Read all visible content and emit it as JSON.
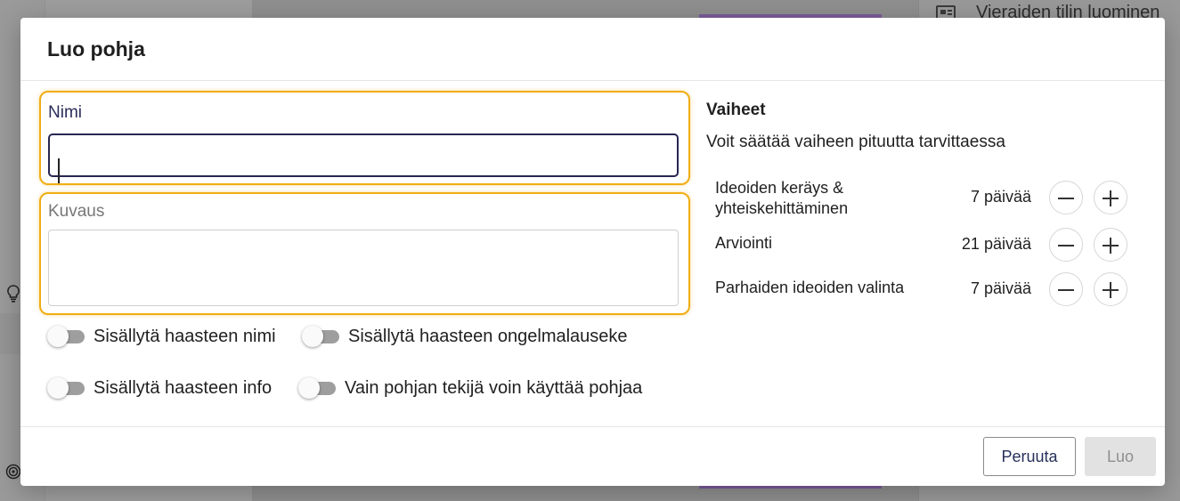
{
  "background": {
    "right_panel_title": "Vieraiden tilin luominen",
    "icons": [
      "newspaper-icon",
      "lightbulb-icon",
      "target-icon"
    ]
  },
  "dialog": {
    "title": "Luo pohja",
    "name_field": {
      "label": "Nimi",
      "value": ""
    },
    "description_field": {
      "label": "Kuvaus",
      "value": ""
    },
    "toggles": [
      {
        "label": "Sisällytä haasteen nimi",
        "on": false
      },
      {
        "label": "Sisällytä haasteen ongelmalauseke",
        "on": false
      },
      {
        "label": "Sisällytä haasteen info",
        "on": false
      },
      {
        "label": "Vain pohjan tekijä voin käyttää pohjaa",
        "on": false
      }
    ],
    "phases": {
      "title": "Vaiheet",
      "subtitle": "Voit säätää vaiheen pituutta tarvittaessa",
      "items": [
        {
          "name": "Ideoiden keräys & yhteiskehittäminen",
          "duration": "7 päivää"
        },
        {
          "name": "Arviointi",
          "duration": "21 päivää"
        },
        {
          "name": "Parhaiden ideoiden valinta",
          "duration": "7 päivää"
        }
      ]
    },
    "buttons": {
      "cancel": "Peruuta",
      "create": "Luo"
    }
  },
  "colors": {
    "focus_outline": "#f0ad15",
    "input_border_active": "#262652",
    "toggle_off": "#9e9e9e",
    "primary_disabled_bg": "#e2e2e2"
  }
}
